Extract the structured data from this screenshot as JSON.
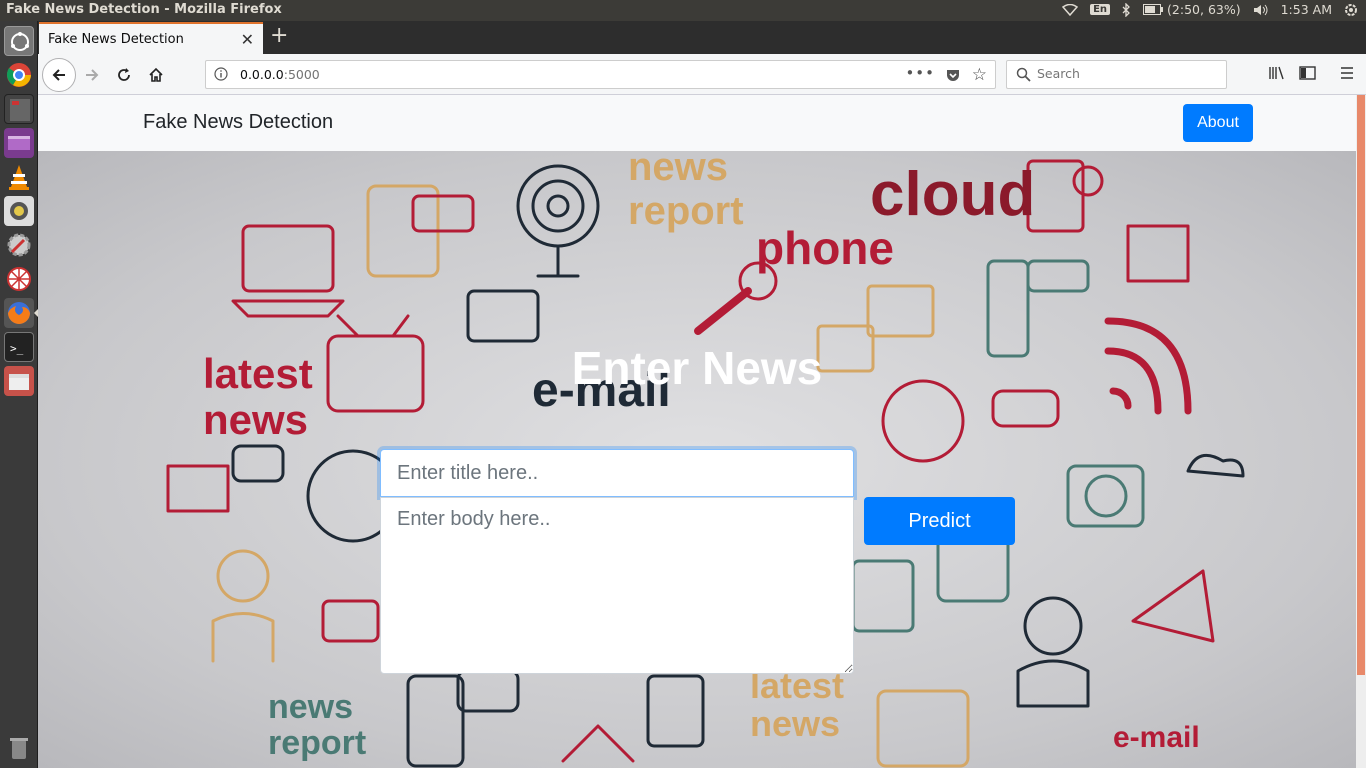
{
  "os": {
    "window_title": "Fake News Detection - Mozilla Firefox",
    "keyboard_layout": "En",
    "battery": "(2:50, 63%)",
    "clock": "1:53 AM"
  },
  "browser": {
    "tab_title": "Fake News Detection",
    "url_host": "0.0.0.0",
    "url_port": ":5000",
    "search_placeholder": "Search"
  },
  "page": {
    "brand": "Fake News Detection",
    "about_label": "About",
    "heading": "Enter News",
    "title_placeholder": "Enter title here..",
    "body_placeholder": "Enter body here..",
    "predict_label": "Predict"
  },
  "background_words": [
    {
      "text": "news report",
      "color": "#d4a766"
    },
    {
      "text": "cloud",
      "color": "#8b1a2b"
    },
    {
      "text": "phone",
      "color": "#b31c36"
    },
    {
      "text": "latest news",
      "color": "#b31c36"
    },
    {
      "text": "e-mail",
      "color": "#1f2a36"
    },
    {
      "text": "news report",
      "color": "#4a7a74"
    },
    {
      "text": "latest news",
      "color": "#d4a766"
    },
    {
      "text": "e-mail",
      "color": "#b31c36"
    }
  ],
  "colors": {
    "primary": "#007bff",
    "navbar_bg": "#f8f9fa",
    "tab_accent": "#e0732d",
    "scroll_thumb": "#e8896a"
  }
}
